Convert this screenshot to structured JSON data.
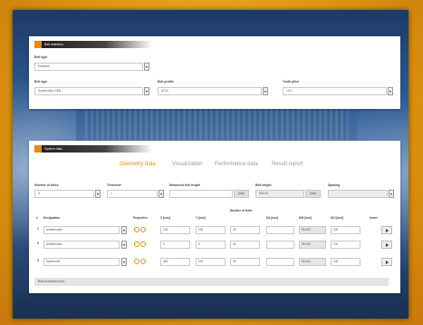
{
  "colors": {
    "accent": "#e58a12",
    "frame": "#e7a61c",
    "background_blue": "#2f5c93"
  },
  "belt_selection": {
    "title": "Belt selection",
    "belt_type_label": "Belt type",
    "belt_type_value": "Elatomer",
    "belt_type2_label": "Belt type",
    "belt_type2_value": "Synchroflex GEN",
    "belt_profile_label": "Belt profile",
    "belt_profile_value": "AT10",
    "tooth_pitch_label": "Tooth pitch",
    "tooth_pitch_value": "10.0"
  },
  "system_data": {
    "title": "System data",
    "tabs": [
      "Geometry data",
      "Visualization",
      "Performance data",
      "Result report"
    ],
    "number_of_discs_label": "Number of discs",
    "number_of_discs_value": "3",
    "tensioner_label": "Tensioner",
    "tensioner_value": "1",
    "measured_belt_length_label": "Measured belt length",
    "measured_belt_length_unit": "[mm]",
    "belt_length_label": "Belt length",
    "belt_length_value": "846.00",
    "belt_length_unit": "[mm]",
    "spacing_label": "Spacing",
    "table": {
      "headers": [
        "#",
        "Designation",
        "Properties",
        "X [mm]",
        "Y [mm]",
        "Number of teeth",
        "DA [mm]",
        "DW [mm]",
        "NCI [mm]",
        "Invert"
      ],
      "rows": [
        {
          "num": "1",
          "designation": "Antriebsrolle",
          "x": "100",
          "y": "100",
          "teeth": "30",
          "da": "",
          "dw": "95.493",
          "nci": "100"
        },
        {
          "num": "2",
          "designation": "Abtriebsrolle",
          "x": "0",
          "y": "0",
          "teeth": "30",
          "da": "",
          "dw": "95.493",
          "nci": "100"
        },
        {
          "num": "3",
          "designation": "Spannrolle",
          "x": "300",
          "y": "100",
          "teeth": "30",
          "da": "",
          "dw": "95.493",
          "nci": "100"
        }
      ]
    },
    "footer": "Bauraumelemente"
  }
}
